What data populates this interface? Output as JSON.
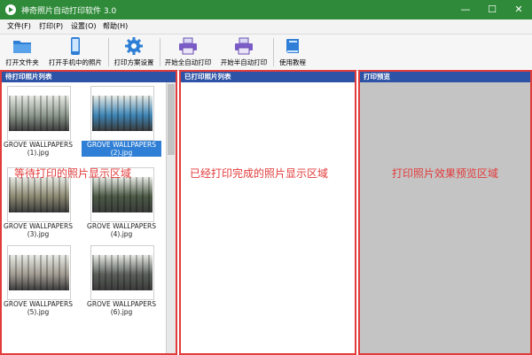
{
  "window": {
    "title": "神奇照片自动打印软件 3.0",
    "minimize": "—",
    "maximize": "☐",
    "close": "✕"
  },
  "menu": [
    "文件(F)",
    "打印(P)",
    "设置(O)",
    "帮助(H)"
  ],
  "toolbar": {
    "open_folder": "打开文件夹",
    "open_phone": "打开手机中的照片",
    "print_settings": "打印方案设置",
    "auto_print": "开始全自动打印",
    "semi_auto_print": "开始半自动打印",
    "tutorial": "使用教程"
  },
  "panels": {
    "waiting": {
      "title": "待打印照片列表",
      "overlay": "等待打印的照片显示区域"
    },
    "printed": {
      "title": "已打印照片列表",
      "overlay": "已经打印完成的照片显示区域"
    },
    "preview": {
      "title": "打印预览",
      "overlay": "打印照片效果预览区域"
    }
  },
  "thumbnails": [
    {
      "line1": "GROVE WALLPAPERS",
      "line2": "(1).jpg",
      "selected": false,
      "color": "#8f9a8f"
    },
    {
      "line1": "GROVE WALLPAPERS",
      "line2": "(2).jpg",
      "selected": true,
      "color": "#3f86b6"
    },
    {
      "line1": "GROVE WALLPAPERS",
      "line2": "(3).jpg",
      "selected": false,
      "color": "#8d8a72"
    },
    {
      "line1": "GROVE WALLPAPERS",
      "line2": "(4).jpg",
      "selected": false,
      "color": "#4c5a46"
    },
    {
      "line1": "GROVE WALLPAPERS",
      "line2": "(5).jpg",
      "selected": false,
      "color": "#a29c93"
    },
    {
      "line1": "GROVE WALLPAPERS",
      "line2": "(6).jpg",
      "selected": false,
      "color": "#5a5f5a"
    }
  ],
  "colors": {
    "title_bar": "#2f8b3a",
    "panel_header": "#2d53a6",
    "highlight_border": "#e23b3b",
    "selection": "#2f7fd6"
  }
}
